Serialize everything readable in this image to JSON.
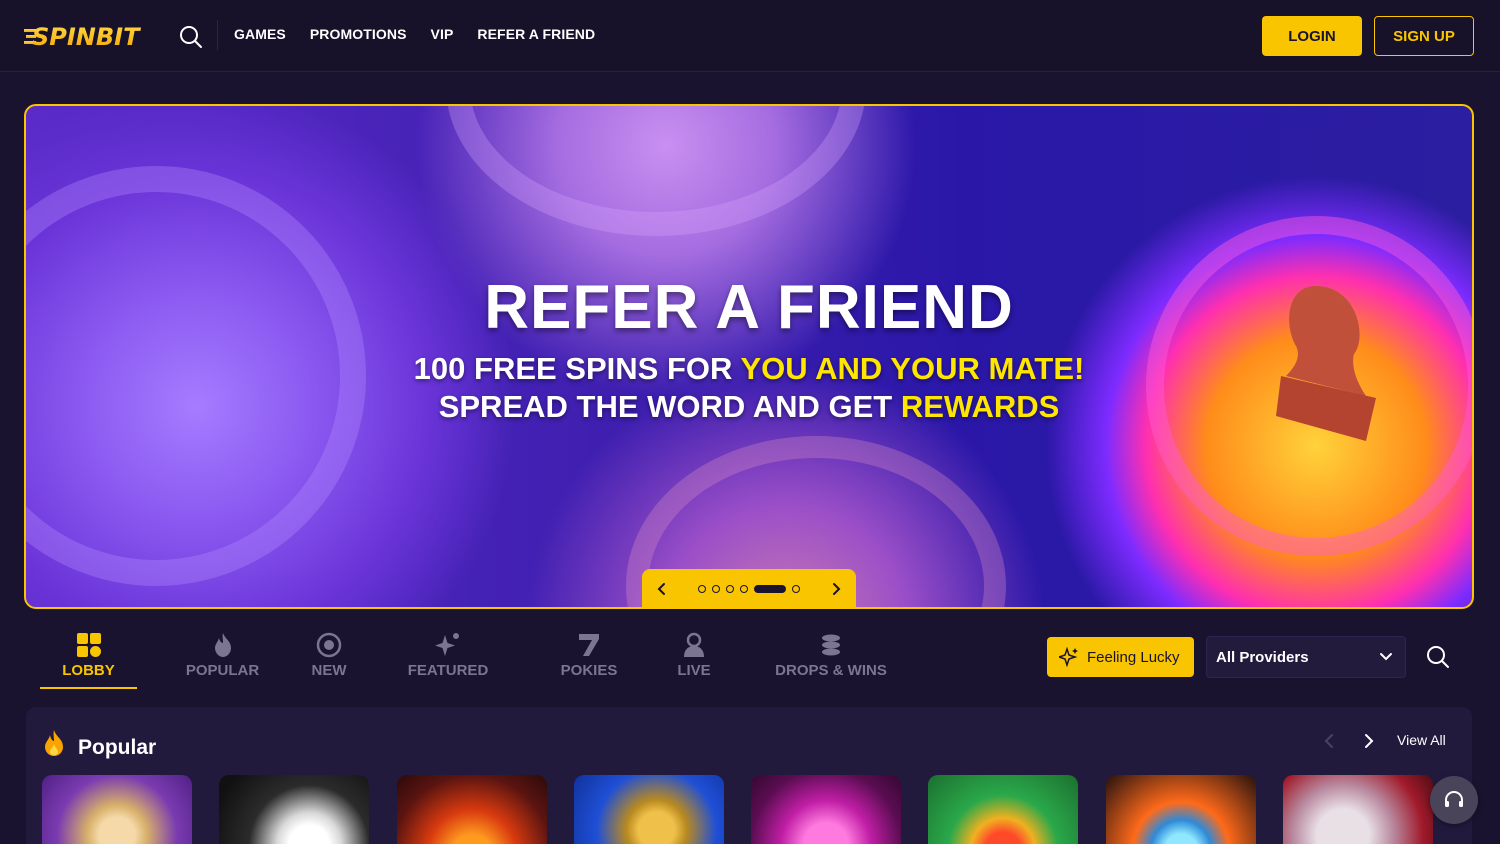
{
  "brand": {
    "name": "SPINBIT",
    "accent": "#f9c400",
    "background": "#1a1330"
  },
  "header": {
    "nav": [
      "GAMES",
      "PROMOTIONS",
      "VIP",
      "REFER A FRIEND"
    ],
    "login_label": "LOGIN",
    "signup_label": "SIGN UP",
    "search_icon": "search-icon"
  },
  "banner": {
    "title": "REFER A FRIEND",
    "line1_pre": "100 FREE SPINS FOR ",
    "line1_highlight": "YOU AND YOUR MATE!",
    "line2_pre": "SPREAD THE WORD AND GET ",
    "line2_highlight": "REWARDS",
    "slides_total": 6,
    "active_slide": 5
  },
  "categories": [
    {
      "label": "LOBBY",
      "icon": "grid-icon",
      "active": true
    },
    {
      "label": "POPULAR",
      "icon": "fire-icon",
      "active": false
    },
    {
      "label": "NEW",
      "icon": "new-icon",
      "active": false
    },
    {
      "label": "FEATURED",
      "icon": "sparkle-icon",
      "active": false
    },
    {
      "label": "POKIES",
      "icon": "seven-icon",
      "active": false
    },
    {
      "label": "LIVE",
      "icon": "dealer-icon",
      "active": false
    },
    {
      "label": "DROPS & WINS",
      "icon": "coins-stack-icon",
      "active": false
    }
  ],
  "feeling_lucky_label": "Feeling Lucky",
  "providers_select": {
    "selected": "All Providers"
  },
  "popular": {
    "title": "Popular",
    "view_all_label": "View All",
    "games": [
      "zeus-game",
      "cartoon-cat-game",
      "volcano-game",
      "steampunk-game",
      "gem-flower-game",
      "golden-coin-game",
      "dragon-gem-game",
      "samurai-game"
    ]
  }
}
